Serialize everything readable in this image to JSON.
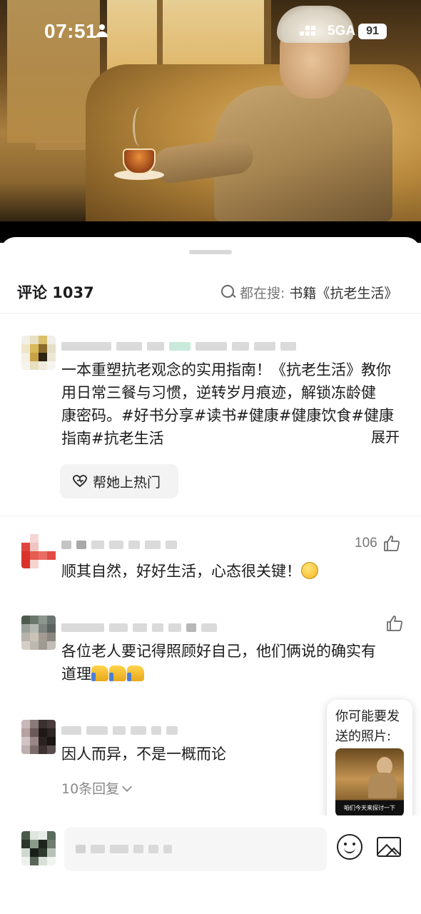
{
  "status_bar": {
    "time": "07:51",
    "network": "5GA",
    "battery": "91"
  },
  "hero": {
    "description_icon": "photo-old-man-tea"
  },
  "comments_header": {
    "title": "评论 1037",
    "search_prefix": "都在搜:",
    "search_term": "书籍《抗老生活》"
  },
  "comments": [
    {
      "text_lines": [
        "一本重塑抗老观念的实用指南！《抗老生活》教你",
        "用日常三餐与习惯，逆转岁月痕迹，解锁冻龄健",
        "康密码。#好书分享#读书#健康#健康饮食#健康",
        "指南#抗老生活"
      ],
      "expand_label": "展开",
      "boost_label": "帮她上热门"
    },
    {
      "text": "顺其自然，好好生活，心态很关键！",
      "likes": "106"
    },
    {
      "text_lines": [
        "各位老人要记得照顾好自己，他们俩说的确实有",
        "道理"
      ]
    },
    {
      "text": "因人而异，不是一概而论",
      "replies_label": "10条回复"
    }
  ],
  "photo_suggestion": {
    "text": "你可能要发送的照片:",
    "thumb_caption": "咱们今天来探讨一下"
  },
  "bottom_bar": {
    "emoji_icon": "smiley-icon",
    "image_icon": "image-icon"
  }
}
